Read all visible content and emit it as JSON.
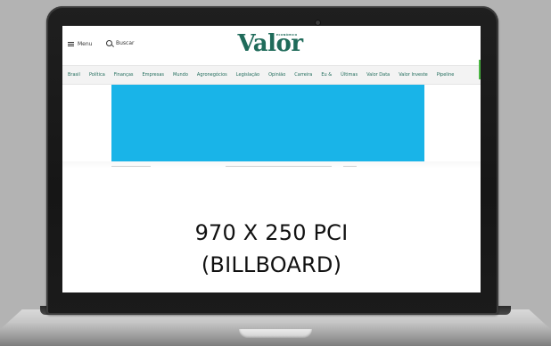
{
  "header": {
    "menu_label": "Menu",
    "search_label": "Buscar",
    "logo_text": "Valor",
    "logo_small": "ECONÔMICO"
  },
  "nav": {
    "items": [
      "Brasil",
      "Política",
      "Finanças",
      "Empresas",
      "Mundo",
      "Agronegócios",
      "Legislação",
      "Opinião",
      "Carreira",
      "Eu &",
      "Últimas",
      "Valor Data",
      "Valor Investe",
      "Pipeline"
    ]
  },
  "ad": {
    "color": "#19b4e8"
  },
  "billboard": {
    "line1": "970 X 250 PCI",
    "line2": "(BILLBOARD)"
  },
  "colors": {
    "brand": "#1f6b5a",
    "background": "#b3b3b3"
  }
}
